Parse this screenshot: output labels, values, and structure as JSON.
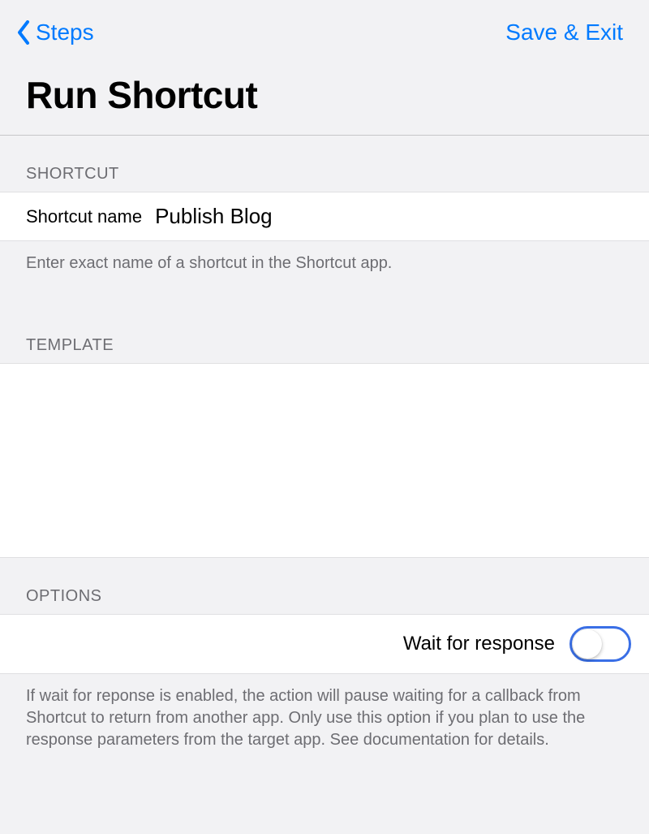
{
  "nav": {
    "back_label": "Steps",
    "save_label": "Save & Exit"
  },
  "page": {
    "title": "Run Shortcut"
  },
  "shortcut": {
    "header": "SHORTCUT",
    "name_label": "Shortcut name",
    "name_value": "Publish Blog",
    "footer": "Enter exact name of a shortcut in the Shortcut app."
  },
  "template": {
    "header": "TEMPLATE",
    "value": ""
  },
  "options": {
    "header": "OPTIONS",
    "wait_label": "Wait for response",
    "wait_value": false,
    "footer": "If wait for reponse is enabled, the action will pause waiting for a callback from Shortcut to return from another app. Only use this option if you plan to use the response parameters from the target app. See documentation for details."
  }
}
